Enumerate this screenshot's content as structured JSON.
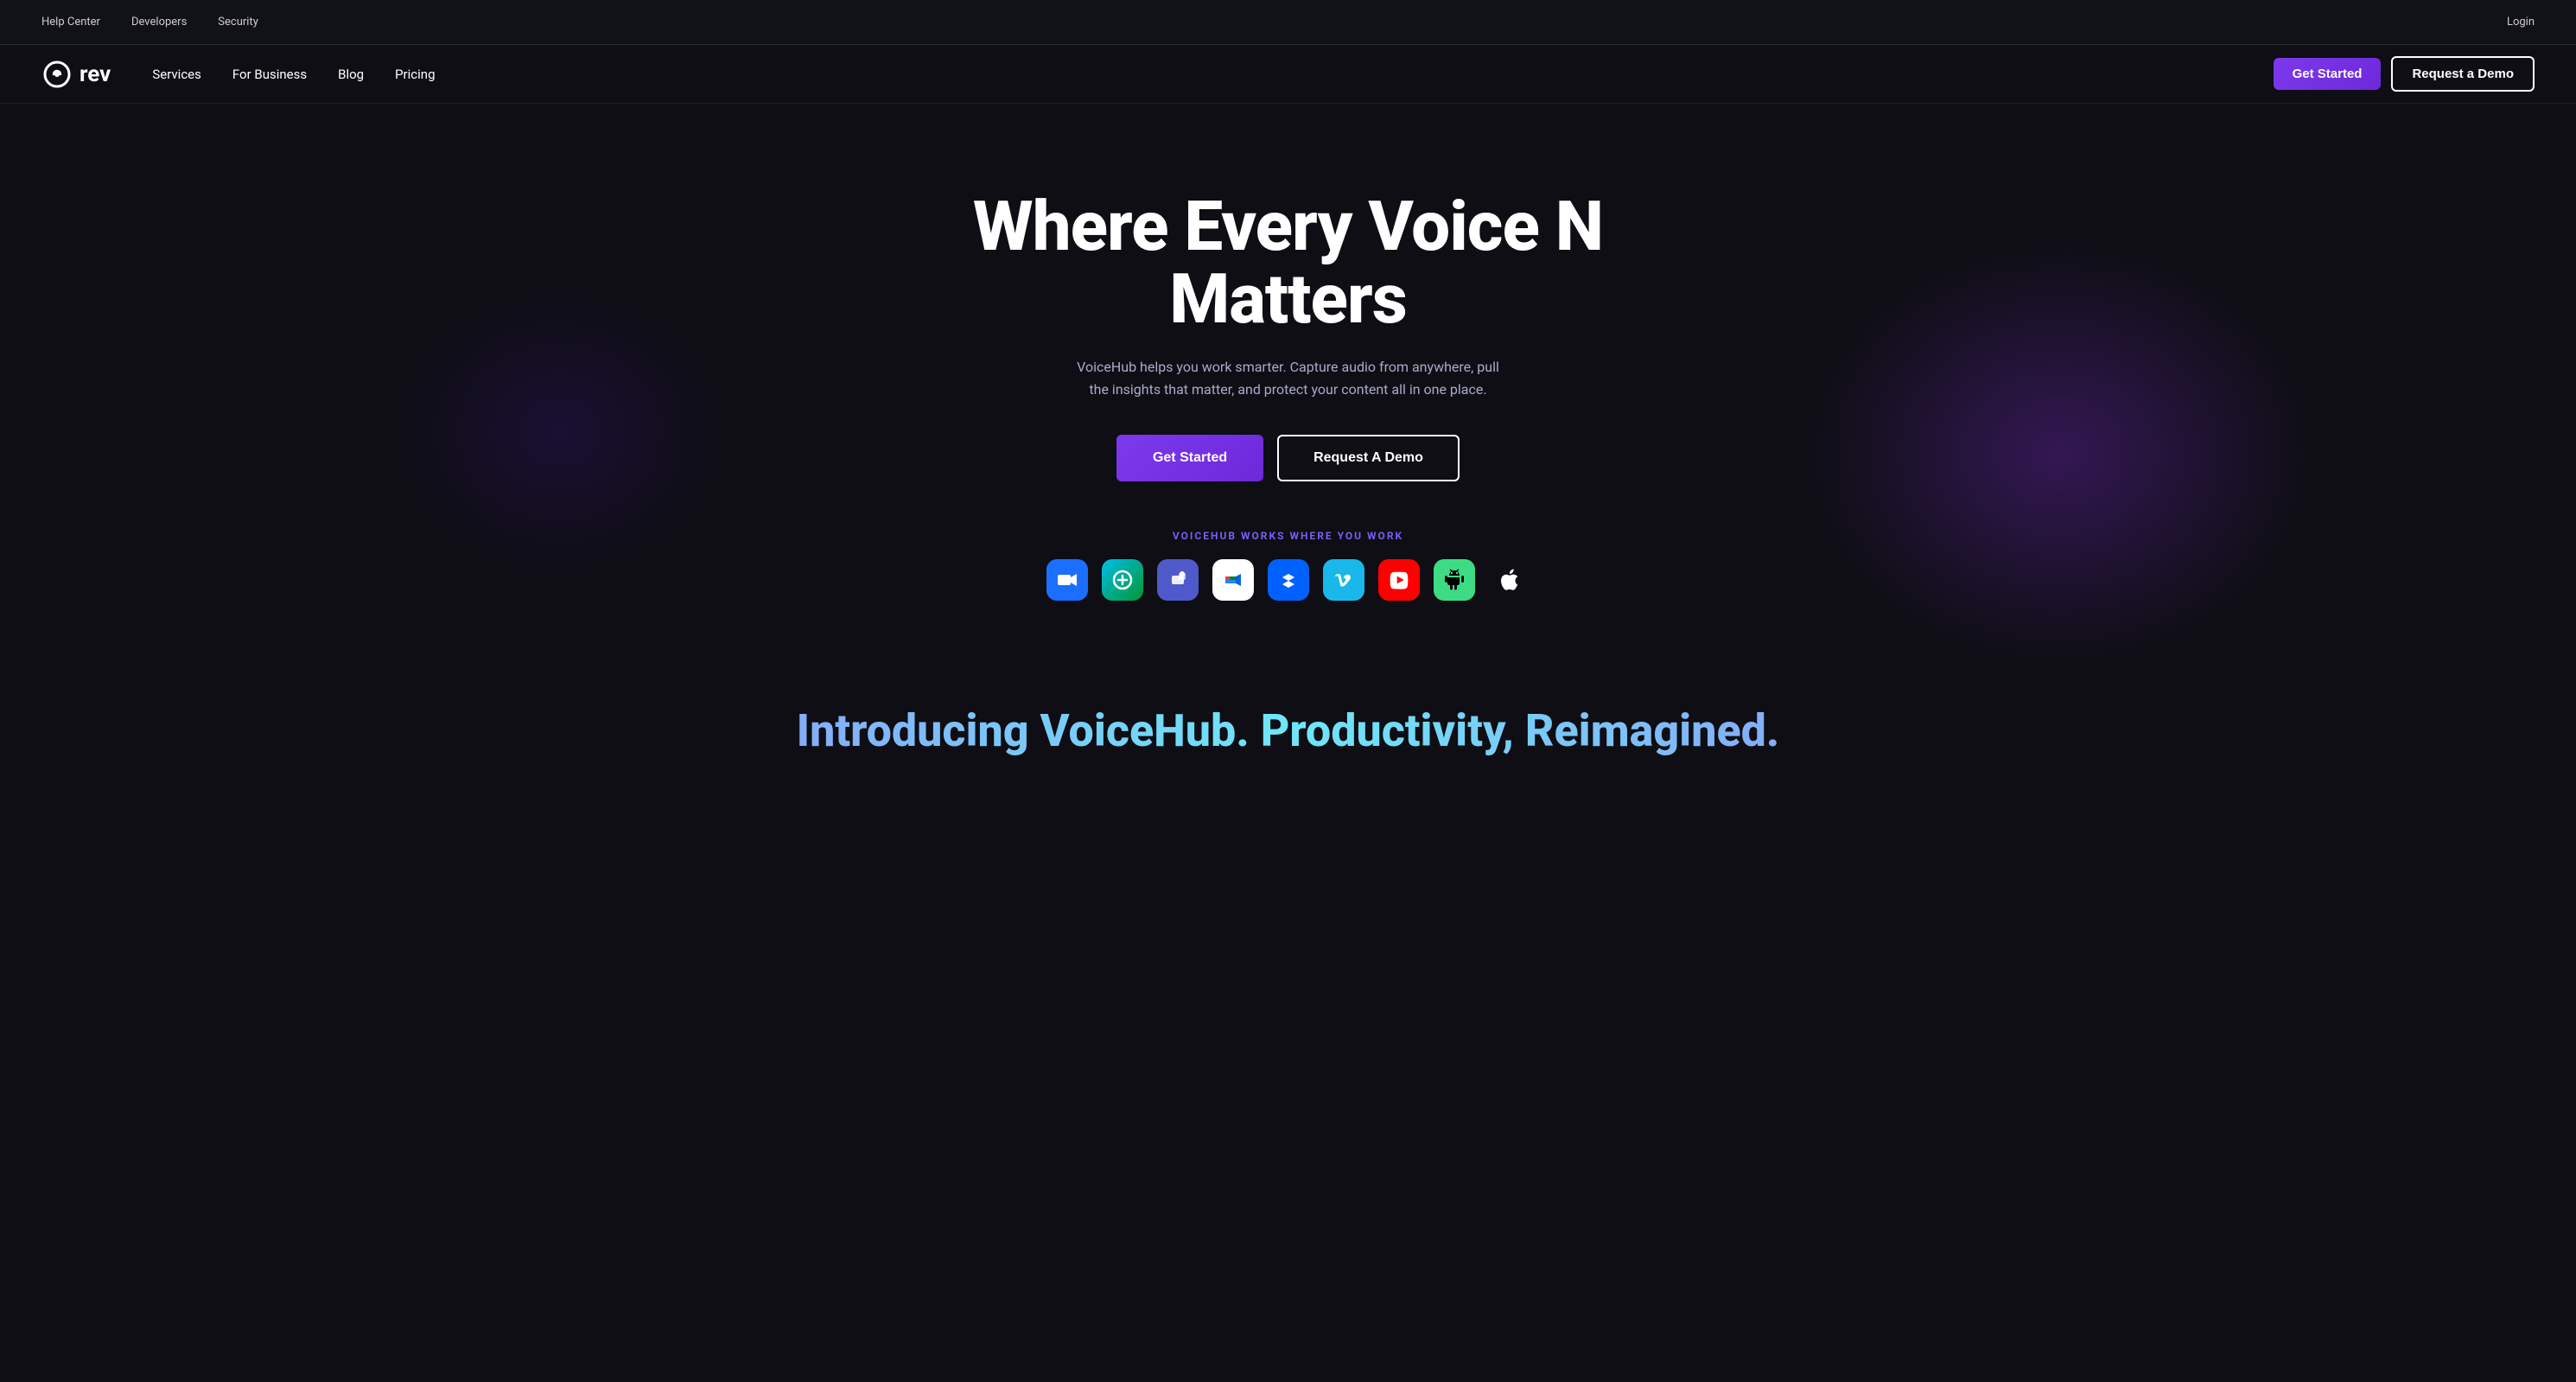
{
  "topBar": {
    "links": [
      {
        "label": "Help Center",
        "name": "help-center-link"
      },
      {
        "label": "Developers",
        "name": "developers-link"
      },
      {
        "label": "Security",
        "name": "security-link"
      }
    ],
    "loginLabel": "Login"
  },
  "mainNav": {
    "logoText": "rev",
    "links": [
      {
        "label": "Services",
        "name": "services-nav-link"
      },
      {
        "label": "For Business",
        "name": "for-business-nav-link"
      },
      {
        "label": "Blog",
        "name": "blog-nav-link"
      },
      {
        "label": "Pricing",
        "name": "pricing-nav-link"
      }
    ],
    "getStartedLabel": "Get Started",
    "requestDemoLabel": "Request a Demo"
  },
  "hero": {
    "title": "Where Every Voice N Matters",
    "subtitle": "VoiceHub helps you work smarter. Capture audio from anywhere, pull the insights that matter, and protect your content all in one place.",
    "primaryButtonLabel": "Get Started",
    "secondaryButtonLabel": "Request A Demo",
    "worksWhereLabel": "VOICEHUB WORKS WHERE YOU WORK",
    "integrations": [
      {
        "name": "zoom",
        "label": "Zoom",
        "icon": "🎥",
        "bgClass": "icon-zoom"
      },
      {
        "name": "webex",
        "label": "Webex",
        "icon": "🌐",
        "bgClass": "icon-webex"
      },
      {
        "name": "teams",
        "label": "Microsoft Teams",
        "icon": "💬",
        "bgClass": "icon-teams"
      },
      {
        "name": "google",
        "label": "Google Meet",
        "icon": "🟦",
        "bgClass": "icon-google"
      },
      {
        "name": "dropbox",
        "label": "Dropbox",
        "icon": "📦",
        "bgClass": "icon-dropbox"
      },
      {
        "name": "vimeo",
        "label": "Vimeo",
        "icon": "▶",
        "bgClass": "icon-vimeo"
      },
      {
        "name": "youtube",
        "label": "YouTube",
        "icon": "▶",
        "bgClass": "icon-youtube"
      },
      {
        "name": "android",
        "label": "Android",
        "icon": "🤖",
        "bgClass": "icon-android"
      },
      {
        "name": "apple",
        "label": "Apple",
        "icon": "🍎",
        "bgClass": "icon-apple"
      }
    ]
  },
  "introducing": {
    "title": "Introducing VoiceHub. Productivity, Reimagined."
  }
}
